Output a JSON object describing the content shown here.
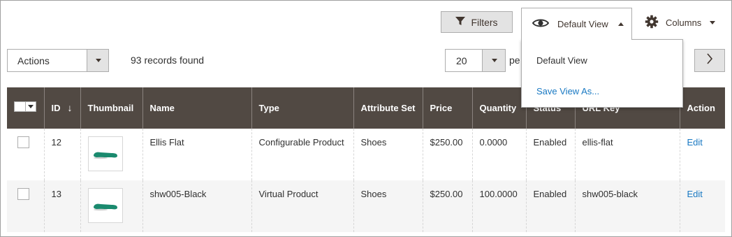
{
  "toolbar": {
    "filters_label": "Filters",
    "view_label": "Default View",
    "columns_label": "Columns"
  },
  "view_menu": {
    "items": [
      "Default View",
      "Save View As..."
    ]
  },
  "actions": {
    "label": "Actions"
  },
  "records_found": "93 records found",
  "pagination": {
    "per_page_value": "20",
    "per_page_label": "pe"
  },
  "grid": {
    "columns": [
      "ID",
      "Thumbnail",
      "Name",
      "Type",
      "Attribute Set",
      "Price",
      "Quantity",
      "Status",
      "URL Key",
      "Action"
    ],
    "rows": [
      {
        "id": "12",
        "name": "Ellis Flat",
        "type": "Configurable Product",
        "attribute_set": "Shoes",
        "price": "$250.00",
        "quantity": "0.0000",
        "status": "Enabled",
        "url_key": "ellis-flat",
        "action": "Edit"
      },
      {
        "id": "13",
        "name": "shw005-Black",
        "type": "Virtual Product",
        "attribute_set": "Shoes",
        "price": "$250.00",
        "quantity": "100.0000",
        "status": "Enabled",
        "url_key": "shw005-black",
        "action": "Edit"
      }
    ]
  },
  "colors": {
    "header_bg": "#514943",
    "link": "#1979c3",
    "button_bg": "#e3e3e3",
    "shoe": "#1a8a6e"
  },
  "icons": [
    "filter-icon",
    "eye-icon",
    "gear-icon",
    "chevron-right-icon"
  ]
}
